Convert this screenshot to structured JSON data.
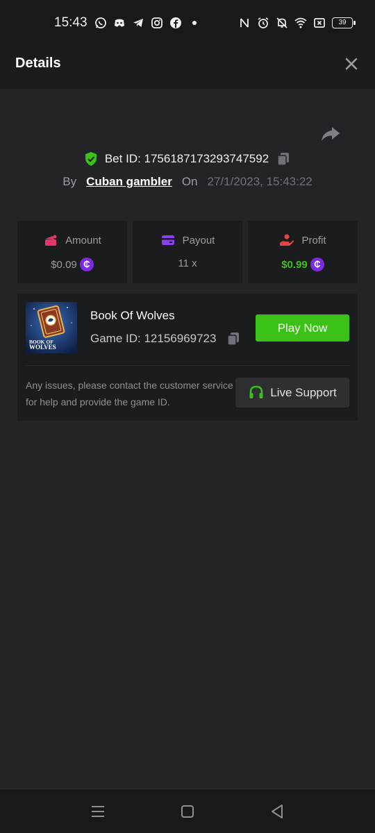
{
  "status_bar": {
    "time": "15:43",
    "battery": "39",
    "left_icons": [
      "whatsapp-icon",
      "discord-icon",
      "telegram-icon",
      "instagram-icon",
      "facebook-icon",
      "dot-icon"
    ],
    "right_icons": [
      "nfc-icon",
      "alarm-icon",
      "bell-off-icon",
      "wifi-icon",
      "x-box-icon",
      "battery-icon"
    ]
  },
  "header": {
    "title": "Details"
  },
  "bet": {
    "bet_id_label": "Bet ID: 1756187173293747592",
    "by_label": "By",
    "user": "Cuban gambler",
    "on_label": "On",
    "date": "27/1/2023, 15:43:22"
  },
  "stats": {
    "amount": {
      "label": "Amount",
      "value": "$0.09"
    },
    "payout": {
      "label": "Payout",
      "value": "11 x"
    },
    "profit": {
      "label": "Profit",
      "value": "$0.99"
    }
  },
  "game": {
    "name": "Book Of Wolves",
    "game_id_label": "Game ID: 12156969723",
    "thumb_text_1": "BOOK OF",
    "thumb_text_2": "WOLVES",
    "play_label": "Play Now",
    "help_text": "Any issues, please contact the customer service for help and provide the game ID.",
    "support_label": "Live Support"
  },
  "colors": {
    "accent_green": "#3bc117",
    "coin_purple": "#7b2ce0",
    "amount_icon": "#e8356b",
    "payout_icon": "#8b3ff0",
    "profit_icon": "#e34545"
  }
}
